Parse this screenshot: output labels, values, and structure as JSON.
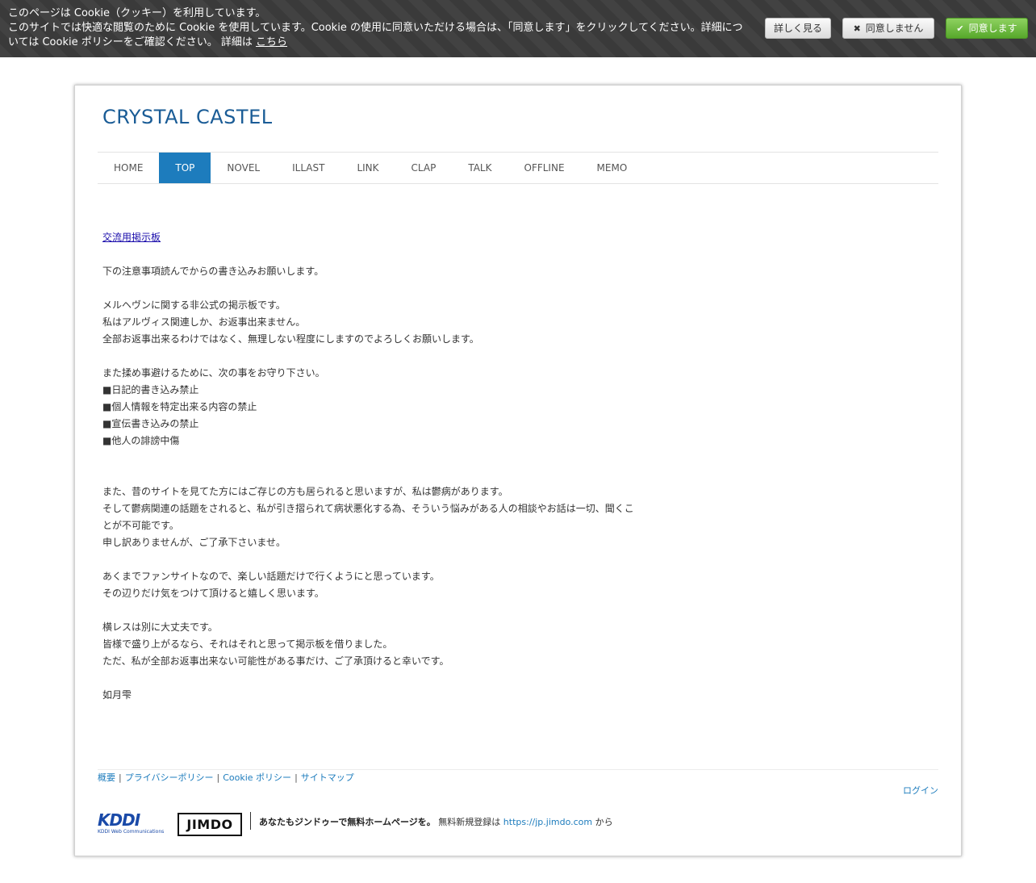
{
  "cookie": {
    "line1": "このページは Cookie（クッキー）を利用しています。",
    "line2": "このサイトでは快適な閲覧のために Cookie を使用しています。Cookie の使用に同意いただける場合は、「同意します」をクリックしてください。詳細につ",
    "line3": "いては Cookie ポリシーをご確認ください。 詳細は ",
    "link": "こちら",
    "more_button": "詳しく見る",
    "decline_button": "同意しません",
    "accept_button": "同意します"
  },
  "site": {
    "title": "CRYSTAL CASTEL"
  },
  "nav": {
    "items": [
      "HOME",
      "TOP",
      "NOVEL",
      "ILLAST",
      "LINK",
      "CLAP",
      "TALK",
      "OFFLINE",
      "MEMO"
    ],
    "active": "TOP"
  },
  "content": {
    "board_link": "交流用掲示板",
    "lines": [
      "",
      "下の注意事項読んでからの書き込みお願いします。",
      "",
      "メルヘヴンに関する非公式の掲示板です。",
      "私はアルヴィス関連しか、お返事出来ません。",
      "全部お返事出来るわけではなく、無理しない程度にしますのでよろしくお願いします。",
      "",
      "また揉め事避けるために、次の事をお守り下さい。",
      "■日記的書き込み禁止",
      "■個人情報を特定出来る内容の禁止",
      "■宣伝書き込みの禁止",
      "■他人の誹謗中傷",
      "",
      "",
      "また、昔のサイトを見てた方にはご存じの方も居られると思いますが、私は鬱病があります。",
      "そして鬱病関連の話題をされると、私が引き摺られて病状悪化する為、そういう悩みがある人の相談やお話は一切、聞くこ",
      "とが不可能です。",
      "申し訳ありませんが、ご了承下さいませ。",
      "",
      "あくまでファンサイトなので、楽しい話題だけで行くようにと思っています。",
      "その辺りだけ気をつけて頂けると嬉しく思います。",
      "",
      "横レスは別に大丈夫です。",
      "皆様で盛り上がるなら、それはそれと思って掲示板を借りました。",
      "ただ、私が全部お返事出来ない可能性がある事だけ、ご了承頂けると幸いです。",
      "",
      "如月雫"
    ]
  },
  "footer": {
    "links": [
      "概要",
      "プライバシーポリシー",
      "Cookie ポリシー",
      "サイトマップ"
    ],
    "separator": "|",
    "login": "ログイン",
    "kddi_logo": "KDDI",
    "kddi_sub": "KDDI Web Communications",
    "jimdo_logo": "JIMDO",
    "promo_bold": "あなたもジンドゥーで無料ホームページを。",
    "promo_text": " 無料新規登録は ",
    "promo_url": "https://jp.jimdo.com",
    "promo_suffix": " から"
  },
  "colors": {
    "accent": "#1d7cbd",
    "title": "#1a5c96",
    "cookie_bar": "#3a3a3a",
    "accept": "#57a82b"
  }
}
